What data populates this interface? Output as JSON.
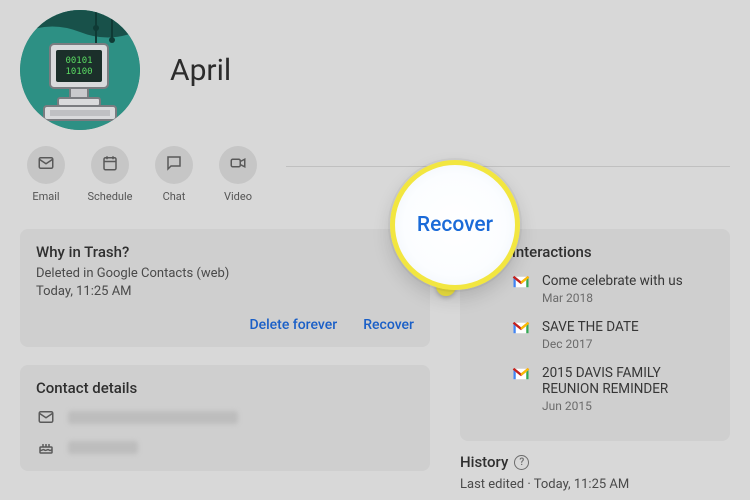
{
  "contact": {
    "name": "April"
  },
  "quickActions": {
    "email": "Email",
    "schedule": "Schedule",
    "chat": "Chat",
    "video": "Video"
  },
  "trash": {
    "title": "Why in Trash?",
    "line1": "Deleted in Google Contacts (web)",
    "line2": "Today, 11:25 AM",
    "deleteLabel": "Delete forever",
    "recoverLabel": "Recover"
  },
  "details": {
    "title": "Contact details"
  },
  "interactionsTitle": "interactions",
  "interactions": [
    {
      "title": "Come celebrate with us",
      "date": "Mar 2018"
    },
    {
      "title": "SAVE THE DATE",
      "date": "Dec 2017"
    },
    {
      "title": "2015 DAVIS FAMILY REUNION REMINDER",
      "date": "Jun 2015"
    }
  ],
  "history": {
    "title": "History",
    "line": "Last edited  ·  Today, 11:25 AM"
  },
  "callout": {
    "label": "Recover"
  }
}
